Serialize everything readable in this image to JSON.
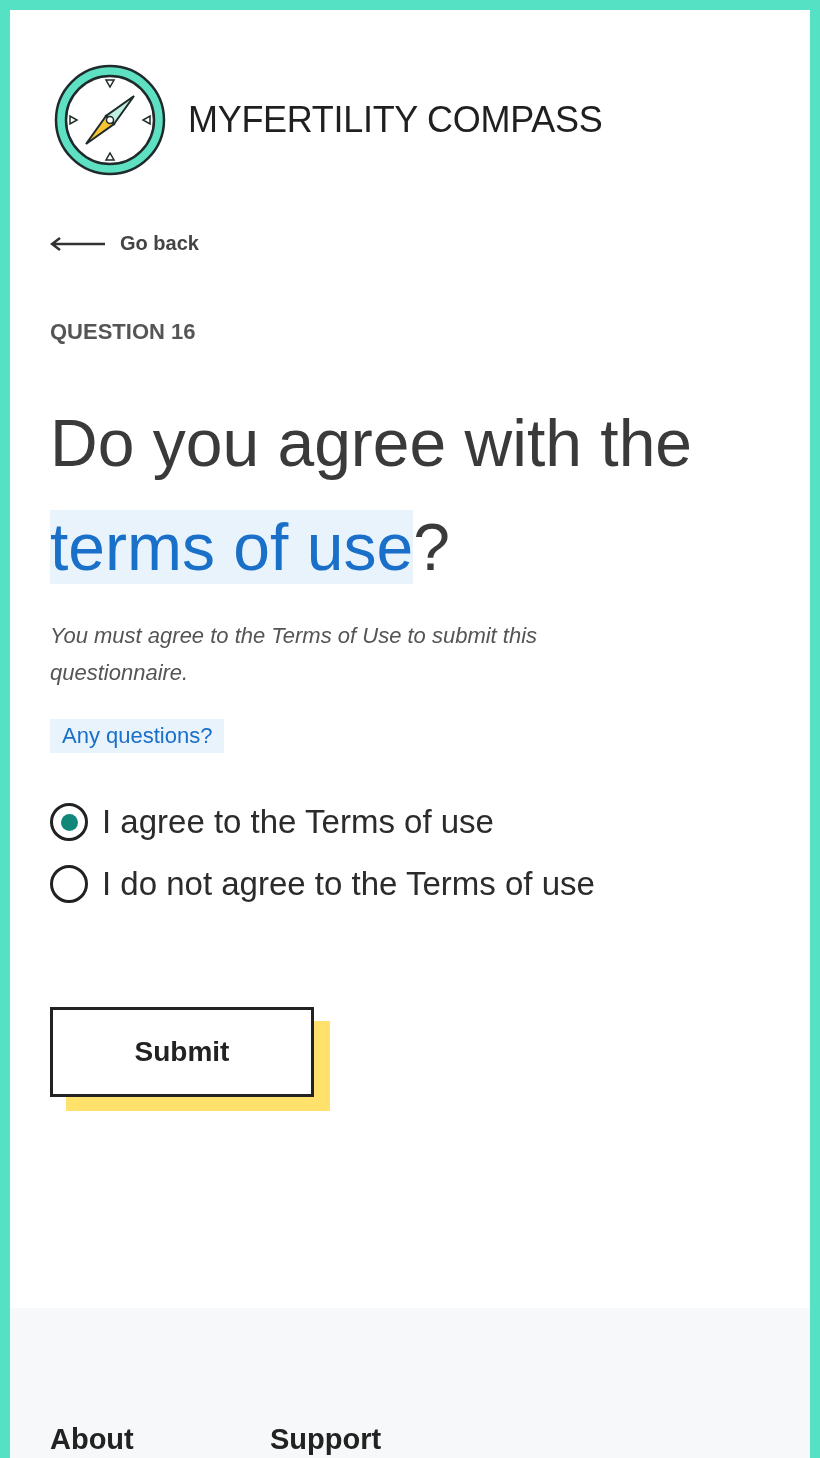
{
  "brand": {
    "name": "MYFERTILITY COMPASS"
  },
  "back": {
    "label": "Go back"
  },
  "question": {
    "number": "QUESTION 16",
    "title_before": "Do you agree with the ",
    "title_link": "terms of use",
    "title_after": "?",
    "note": "You must agree to the Terms of Use to submit this questionnaire.",
    "help": "Any questions?"
  },
  "options": [
    {
      "label": "I agree to the Terms of use",
      "selected": true
    },
    {
      "label": "I do not agree to the Terms of use",
      "selected": false
    }
  ],
  "submit": {
    "label": "Submit"
  },
  "footer": {
    "headings": [
      "About",
      "Support"
    ]
  }
}
